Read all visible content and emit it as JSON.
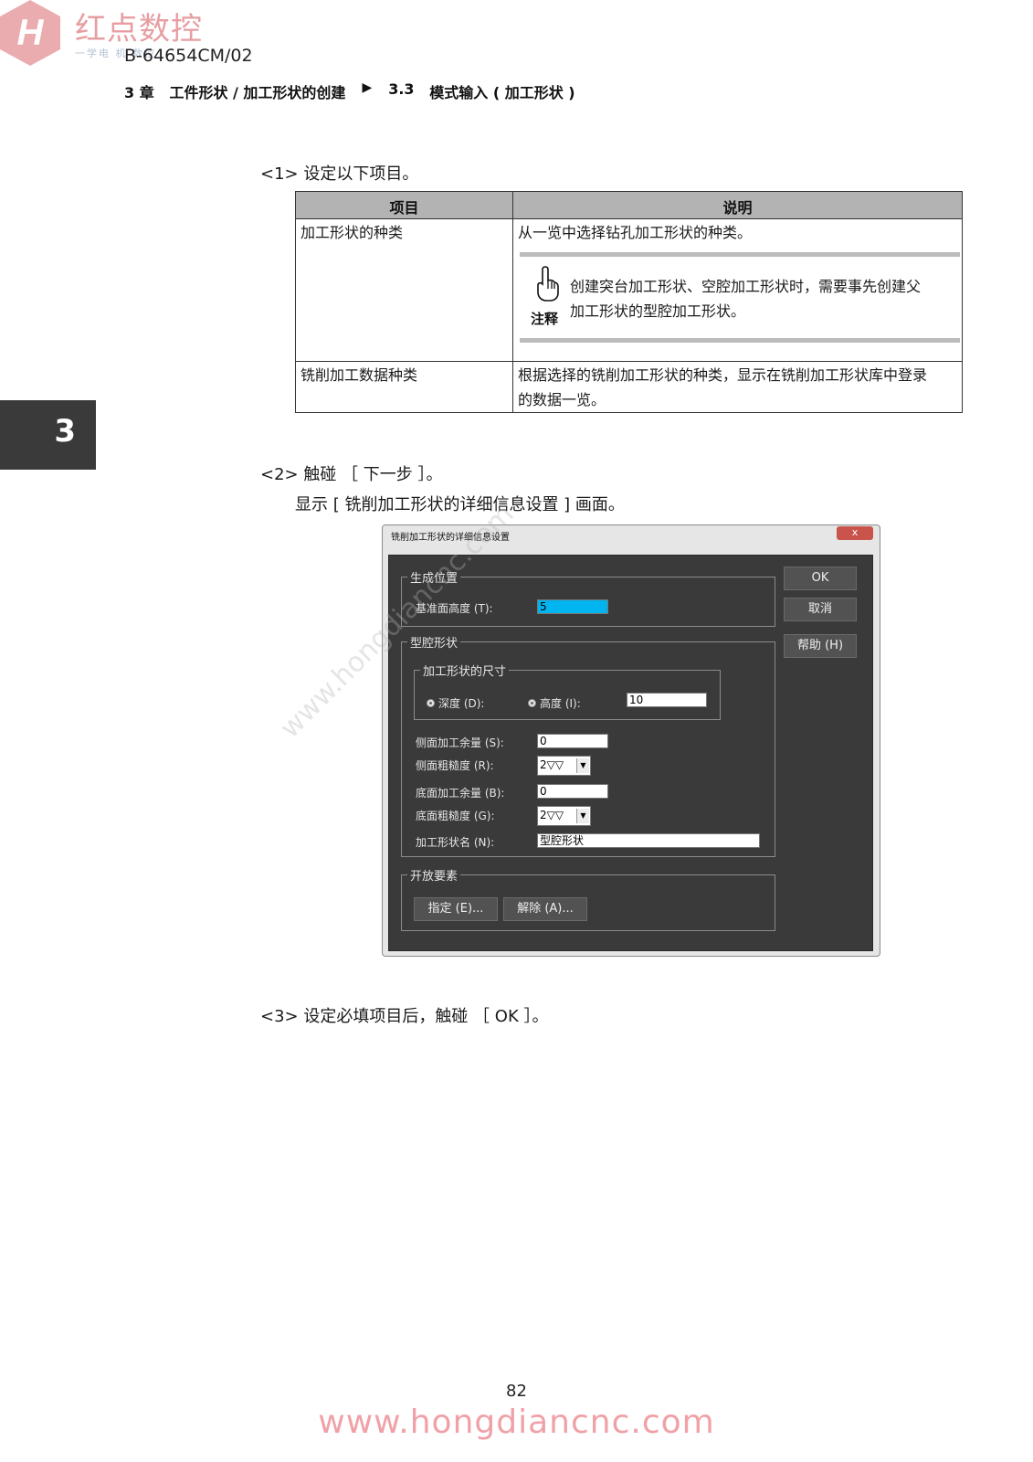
{
  "header": {
    "logo_letter": "H",
    "logo_name": "红点数控",
    "logo_sub": "一学电 机 数控",
    "doc_code": "B-64654CM/02",
    "chapter": "3 章",
    "chapter_title": "工件形状 / 加工形状的创建",
    "arrow": "▶",
    "section_no": "3.3",
    "section_title": "模式输入 ( 加工形状 )"
  },
  "chapter_tab": "3",
  "step1": "<1> 设定以下项目。",
  "table": {
    "col1_header": "项目",
    "col2_header": "说明",
    "rows": [
      {
        "item": "加工形状的种类",
        "desc": "从一览中选择钻孔加工形状的种类。",
        "note_label": "注释",
        "note_line1": "创建突台加工形状、空腔加工形状时，需要事先创建父",
        "note_line2": "加工形状的型腔加工形状。"
      },
      {
        "item": "铣削加工数据种类",
        "desc_line1": "根据选择的铣削加工形状的种类，显示在铣削加工形状库中登录",
        "desc_line2": "的数据一览。"
      }
    ]
  },
  "step2": "<2> 触碰 ［ 下一步 ］。",
  "step2_sub": "显示 [ 铣削加工形状的详细信息设置 ] 画面。",
  "dialog": {
    "title": "铣削加工形状的详细信息设置",
    "close": "x",
    "group_gen": "生成位置",
    "base_height_label": "基准面高度 (T):",
    "base_height_value": "5",
    "group_pocket": "型腔形状",
    "group_size": "加工形状的尺寸",
    "depth_label": "深度 (D):",
    "height_label": "高度 (I):",
    "height_value": "10",
    "side_allow_label": "侧面加工余量 (S):",
    "side_allow_value": "0",
    "side_rough_label": "侧面粗糙度 (R):",
    "side_rough_value": "2▽▽",
    "bottom_allow_label": "底面加工余量 (B):",
    "bottom_allow_value": "0",
    "bottom_rough_label": "底面粗糙度 (G):",
    "bottom_rough_value": "2▽▽",
    "shape_name_label": "加工形状名 (N):",
    "shape_name_value": "型腔形状",
    "group_open": "开放要素",
    "btn_specify": "指定 (E)...",
    "btn_release": "解除 (A)...",
    "btn_ok": "OK",
    "btn_cancel": "取消",
    "btn_help": "帮助 (H)",
    "highlight_color": "#00b4f0"
  },
  "step3": "<3>  设定必填项目后，触碰 ［ OK ］。",
  "page_number": "82",
  "watermark_url": "www.hongdiancnc.com",
  "watermark_diag": "www.hongdiancnc.com"
}
